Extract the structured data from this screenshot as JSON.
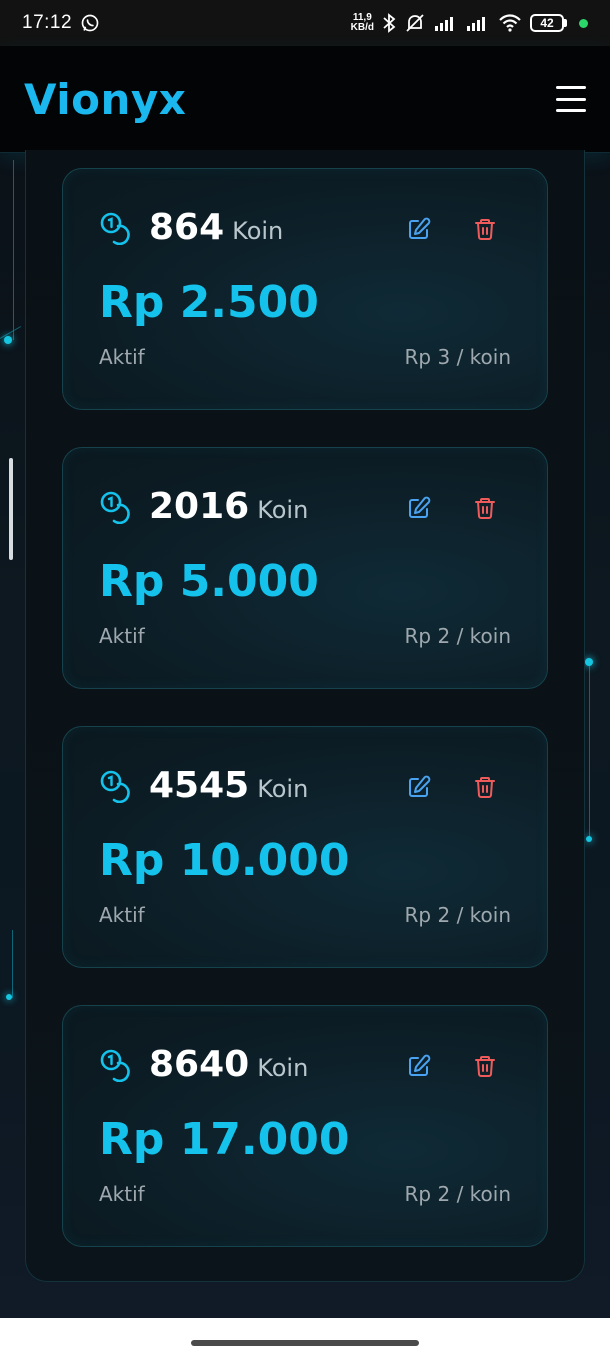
{
  "status_bar": {
    "time": "17:12",
    "speed_value": "11,9",
    "speed_unit": "KB/d",
    "battery": "42"
  },
  "header": {
    "brand": "Vionyx",
    "menu_icon": "hamburger-menu-icon"
  },
  "packages": [
    {
      "amount": "864",
      "unit": "Koin",
      "price": "Rp 2.500",
      "status": "Aktif",
      "rate": "Rp 3 / koin"
    },
    {
      "amount": "2016",
      "unit": "Koin",
      "price": "Rp 5.000",
      "status": "Aktif",
      "rate": "Rp 2 / koin"
    },
    {
      "amount": "4545",
      "unit": "Koin",
      "price": "Rp 10.000",
      "status": "Aktif",
      "rate": "Rp 2 / koin"
    },
    {
      "amount": "8640",
      "unit": "Koin",
      "price": "Rp 17.000",
      "status": "Aktif",
      "rate": "Rp 2 / koin"
    }
  ],
  "colors": {
    "accent": "#14c2ec",
    "edit": "#4aa3f0",
    "delete": "#ef5b5b",
    "card_border": "#16424c"
  }
}
